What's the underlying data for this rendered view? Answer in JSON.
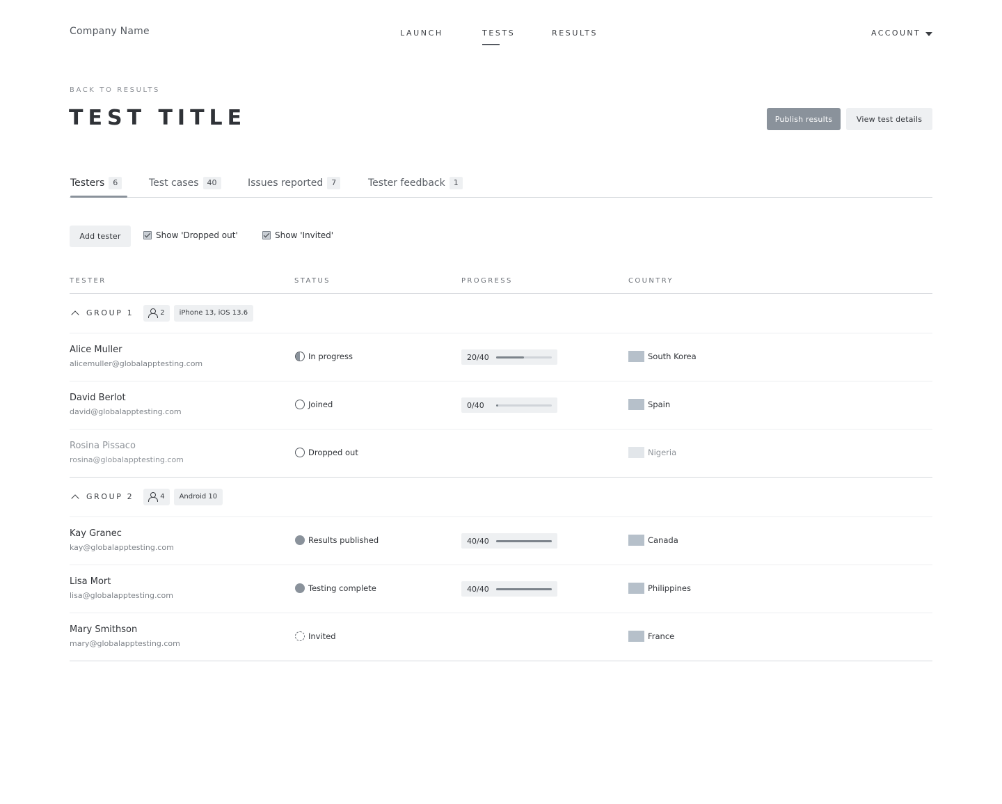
{
  "header": {
    "company": "Company Name",
    "nav": [
      "LAUNCH",
      "TESTS",
      "RESULTS"
    ],
    "active_nav": "TESTS",
    "account": "ACCOUNT"
  },
  "page": {
    "back_link": "BACK TO RESULTS",
    "title": "TEST TITLE",
    "publish_button": "Publish results",
    "details_button": "View test details"
  },
  "tabs": [
    {
      "label": "Testers",
      "count": "6",
      "active": true
    },
    {
      "label": "Test cases",
      "count": "40",
      "active": false
    },
    {
      "label": "Issues reported",
      "count": "7",
      "active": false
    },
    {
      "label": "Tester feedback",
      "count": "1",
      "active": false
    }
  ],
  "toolbar": {
    "add_tester": "Add tester",
    "show_dropped": "Show 'Dropped out'",
    "show_invited": "Show 'Invited'",
    "show_dropped_checked": true,
    "show_invited_checked": true
  },
  "table": {
    "columns": [
      "TESTER",
      "STATUS",
      "PROGRESS",
      "COUNTRY"
    ],
    "groups": [
      {
        "label": "GROUP 1",
        "count": "2",
        "device": "iPhone 13, iOS 13.6",
        "testers": [
          {
            "name": "Alice Muller",
            "email": "alicemuller@globalapptesting.com",
            "status": "In progress",
            "status_icon": "half-circle-icon",
            "progress": "20/40",
            "progress_fraction": 0.5,
            "country": "South Korea"
          },
          {
            "name": "David Berlot",
            "email": "david@globalapptesting.com",
            "status": "Joined",
            "status_icon": "empty-circle-icon",
            "progress": "0/40",
            "progress_fraction": 0.0,
            "country": "Spain"
          },
          {
            "name": "Rosina Pissaco",
            "email": "rosina@globalapptesting.com",
            "status": "Dropped out",
            "status_icon": "empty-circle-icon",
            "progress": "",
            "country": "Nigeria"
          }
        ]
      },
      {
        "label": "GROUP 2",
        "count": "4",
        "device": "Android 10",
        "testers": [
          {
            "name": "Kay Granec",
            "email": "kay@globalapptesting.com",
            "status": "Results published",
            "status_icon": "filled-circle-icon",
            "progress": "40/40",
            "progress_fraction": 1.0,
            "country": "Canada"
          },
          {
            "name": "Lisa Mort",
            "email": "lisa@globalapptesting.com",
            "status": "Testing complete",
            "status_icon": "filled-circle-icon",
            "progress": "40/40",
            "progress_fraction": 1.0,
            "country": "Philippines"
          },
          {
            "name": "Mary Smithson",
            "email": "mary@globalapptesting.com",
            "status": "Invited",
            "status_icon": "dashed-circle-icon",
            "progress": "",
            "country": "France"
          }
        ]
      }
    ]
  },
  "colors": {
    "accent": "#8a929b",
    "text": "#2f3237",
    "muted": "#8e9399",
    "chip_bg": "#eef0f2"
  }
}
